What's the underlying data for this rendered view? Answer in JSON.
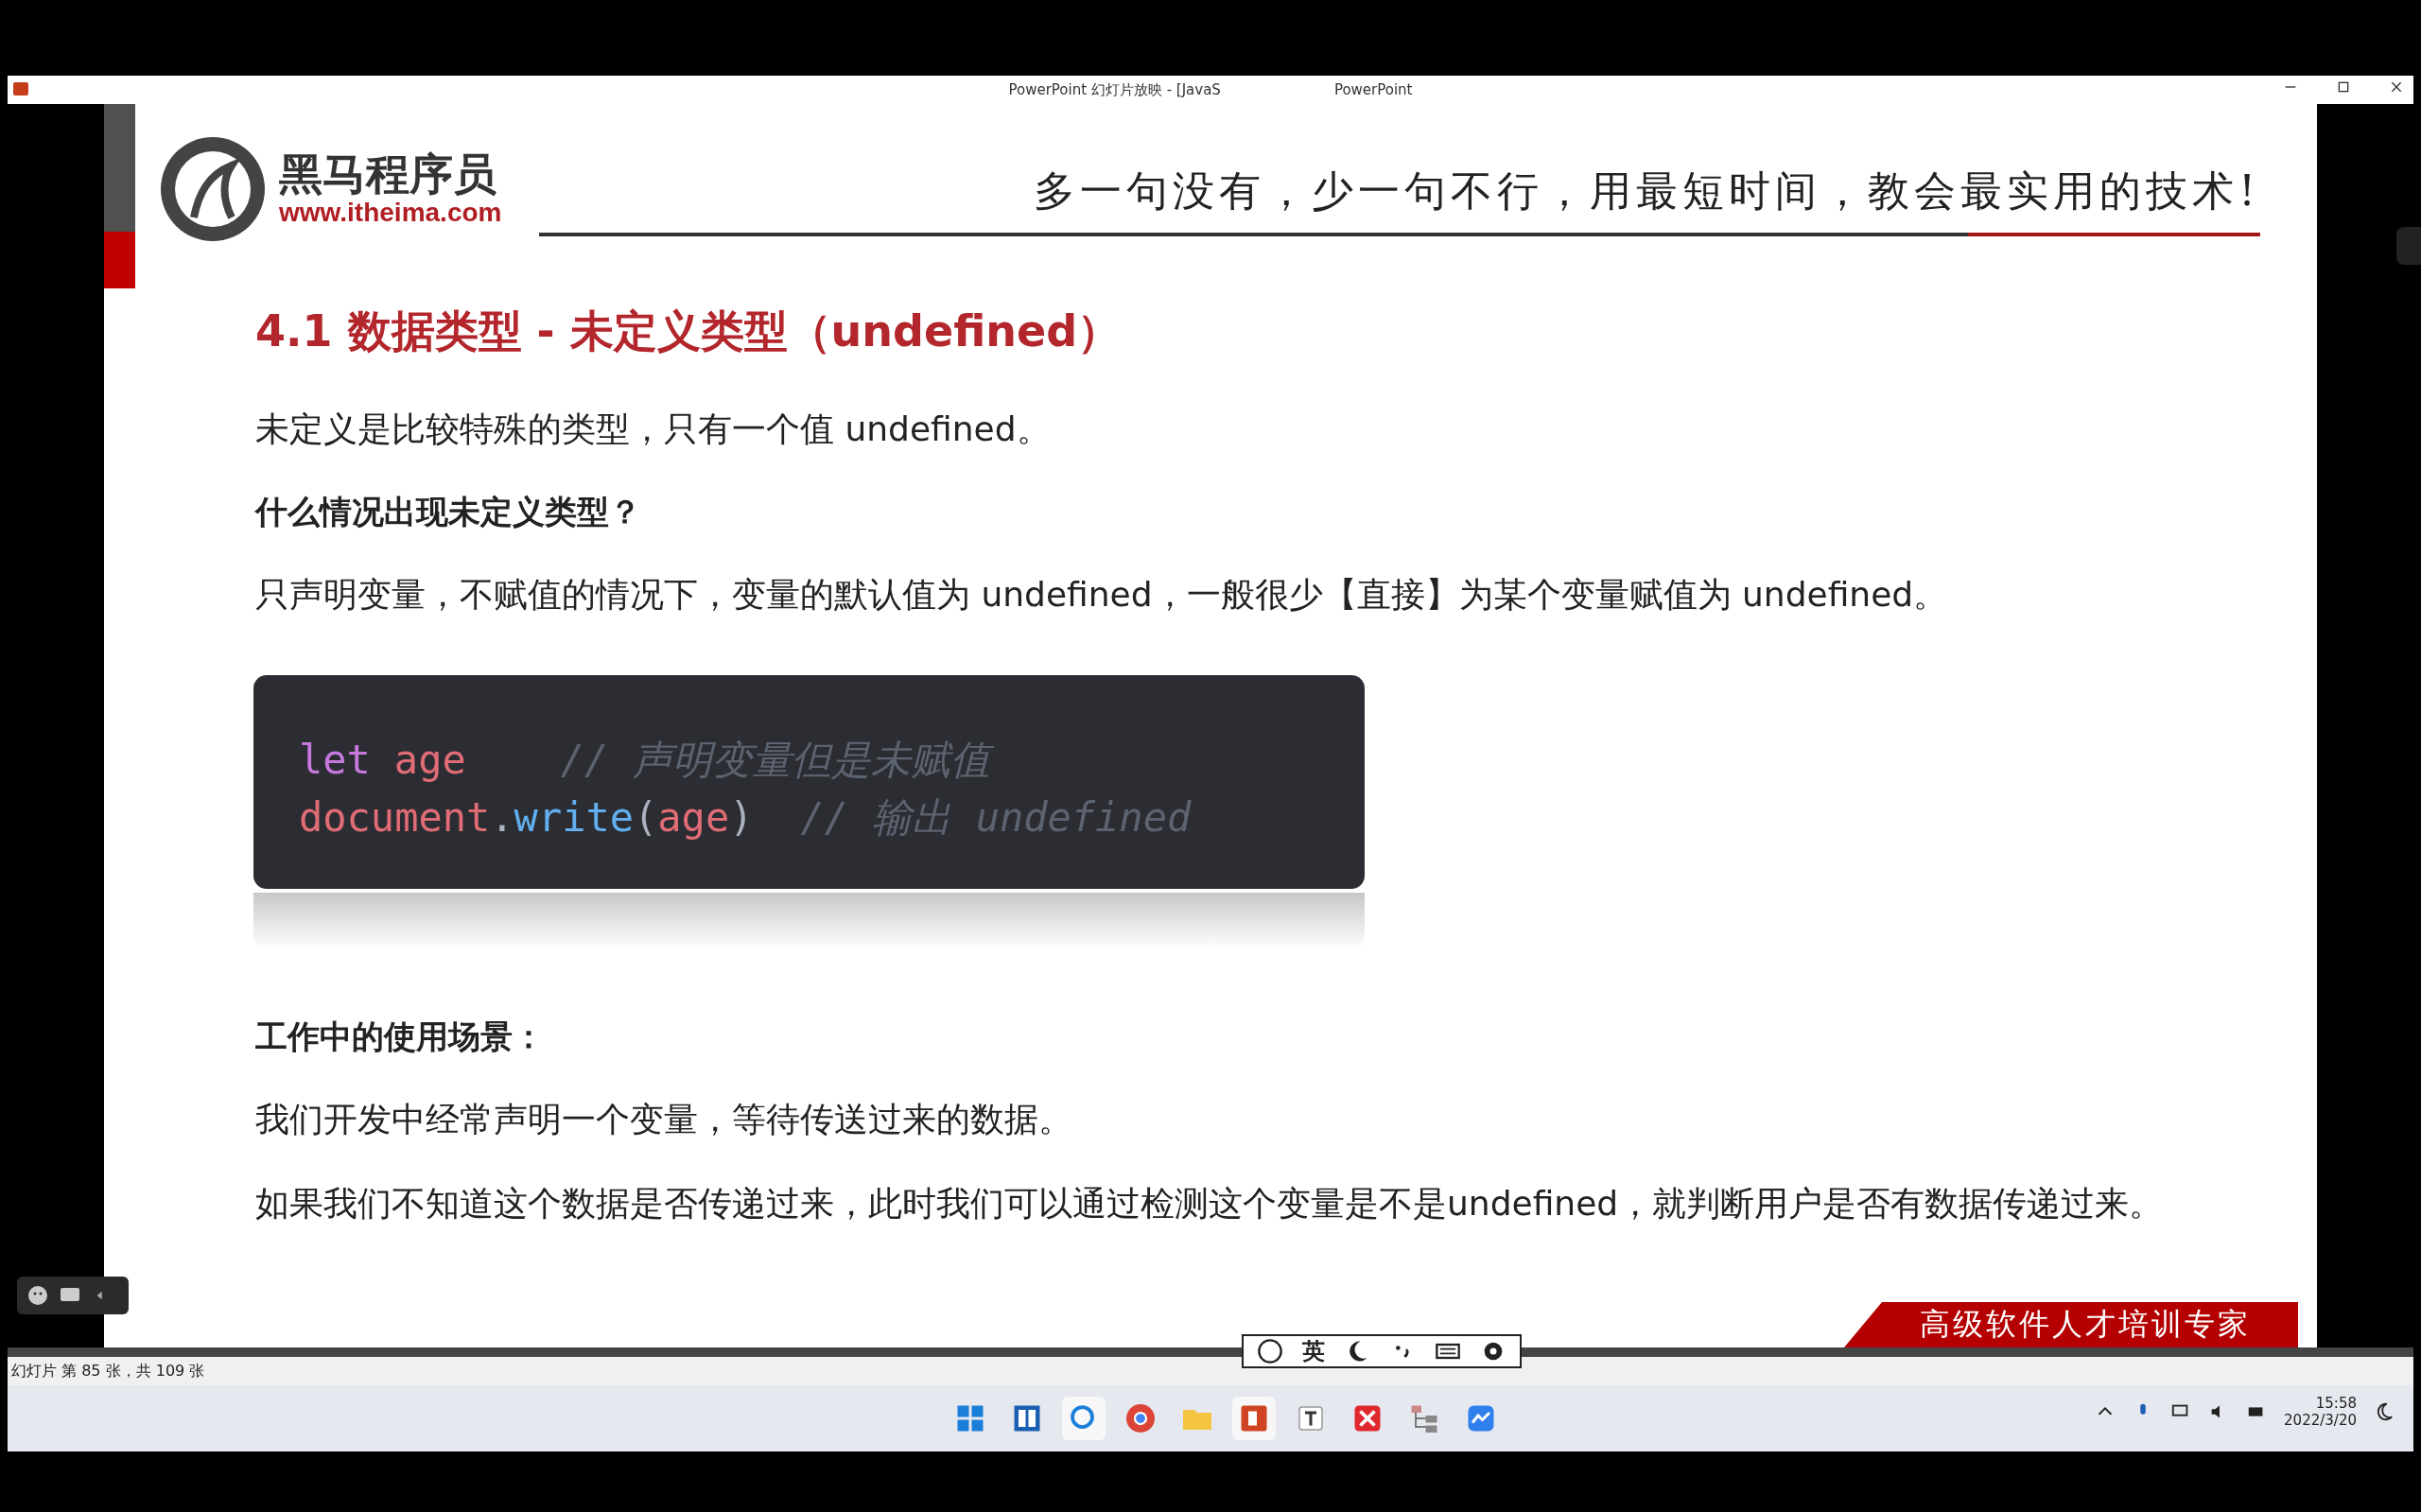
{
  "window": {
    "title": "PowerPoint 幻灯片放映 - [JavaS",
    "title_tail": "PowerPoint"
  },
  "slide": {
    "brand": {
      "name": "黑马程序员",
      "url": "www.itheima.com"
    },
    "slogan": "多一句没有，少一句不行，用最短时间，教会最实用的技术!",
    "title": "4.1 数据类型 - 未定义类型（undefined）",
    "blocks": [
      {
        "kind": "para",
        "text": "未定义是比较特殊的类型，只有一个值 undefined。"
      },
      {
        "kind": "heading",
        "text": "什么情况出现未定义类型？"
      },
      {
        "kind": "para",
        "text": "只声明变量，不赋值的情况下，变量的默认值为 undefined，一般很少【直接】为某个变量赋值为 undefined。"
      },
      {
        "kind": "code",
        "lines": [
          [
            {
              "kind": "keyword",
              "text": "let"
            },
            {
              "kind": "variable",
              "text": "age"
            },
            {
              "kind": "comment",
              "text": "// 声明变量但是未赋值"
            }
          ],
          [
            {
              "kind": "variable",
              "text": "document"
            },
            {
              "kind": "plain",
              "text": "."
            },
            {
              "kind": "function",
              "text": "write"
            },
            {
              "kind": "plain",
              "text": "("
            },
            {
              "kind": "variable",
              "text": "age"
            },
            {
              "kind": "plain",
              "text": ")"
            },
            {
              "kind": "comment",
              "text": "// 输出 undefined"
            }
          ]
        ]
      },
      {
        "kind": "heading",
        "text": "工作中的使用场景："
      },
      {
        "kind": "para",
        "text": "我们开发中经常声明一个变量，等待传送过来的数据。"
      },
      {
        "kind": "para",
        "text": "如果我们不知道这个数据是否传递过来，此时我们可以通过检测这个变量是不是undefined，就判断用户是否有数据传递过来。"
      }
    ],
    "banner": "高级软件人才培训专家"
  },
  "status_bar": "幻灯片 第 85 张，共 109 张",
  "ime": {
    "mode": "英"
  },
  "clock": {
    "time": "15:58",
    "date": "2022/3/20"
  }
}
